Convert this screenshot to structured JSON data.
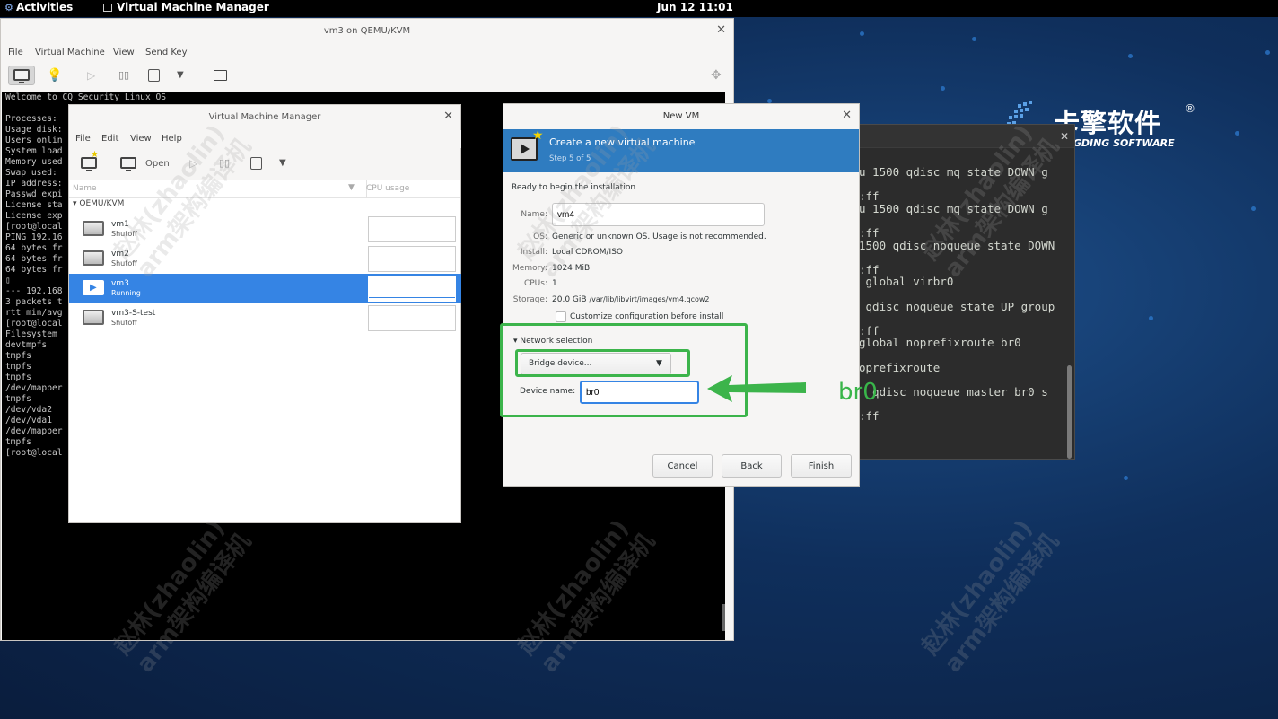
{
  "topbar": {
    "activities": "Activities",
    "app_name": "Virtual Machine Manager",
    "clock": "Jun 12  11:01"
  },
  "brand": {
    "cn": "卡擎软件",
    "en": "KINGDING SOFTWARE",
    "reg": "®"
  },
  "bg_terminal": {
    "lines": [
      "u 1500 qdisc mq state DOWN g",
      "",
      ":ff",
      "u 1500 qdisc mq state DOWN g",
      "",
      ":ff",
      "1500 qdisc noqueue state DOWN",
      "",
      ":ff",
      " global virbr0",
      "",
      " qdisc noqueue state UP group",
      "",
      ":ff",
      "global noprefixroute br0",
      "",
      "oprefixroute",
      "",
      "  qdisc noqueue master br0 s",
      "",
      ":ff"
    ]
  },
  "viewer": {
    "title": "vm3 on QEMU/KVM",
    "menu": [
      "File",
      "Virtual Machine",
      "View",
      "Send Key"
    ],
    "console_lines": [
      "Welcome to CQ Security Linux OS",
      "",
      "Processes:",
      "Usage disk:",
      "Users onlin",
      "System load",
      "Memory used",
      "Swap used:",
      "IP address:",
      "Passwd expi",
      "License sta",
      "License exp",
      "[root@local",
      "PING 192.16",
      "64 bytes fr",
      "64 bytes fr",
      "64 bytes fr",
      "▯",
      "--- 192.168",
      "3 packets t",
      "rtt min/avg",
      "[root@local",
      "Filesystem",
      "devtmpfs",
      "tmpfs",
      "tmpfs",
      "tmpfs",
      "/dev/mapper",
      "tmpfs",
      "/dev/vda2",
      "/dev/vda1",
      "/dev/mapper",
      "tmpfs",
      "[root@local"
    ]
  },
  "vmm": {
    "title": "Virtual Machine Manager",
    "menu": [
      "File",
      "Edit",
      "View",
      "Help"
    ],
    "toolbar": {
      "open": "Open"
    },
    "columns": {
      "name": "Name",
      "cpu": "CPU usage"
    },
    "group": "QEMU/KVM",
    "vms": [
      {
        "name": "vm1",
        "status": "Shutoff"
      },
      {
        "name": "vm2",
        "status": "Shutoff"
      },
      {
        "name": "vm3",
        "status": "Running"
      },
      {
        "name": "vm3-S-test",
        "status": "Shutoff"
      }
    ]
  },
  "newvm": {
    "title": "New VM",
    "banner_title": "Create a new virtual machine",
    "banner_step": "Step 5 of 5",
    "ready": "Ready to begin the installation",
    "labels": {
      "name": "Name:",
      "os": "OS:",
      "install": "Install:",
      "memory": "Memory:",
      "cpus": "CPUs:",
      "storage": "Storage:"
    },
    "name_value": "vm4",
    "os_value": "Generic or unknown OS. Usage is not recommended.",
    "install_value": "Local CDROM/ISO",
    "memory_value": "1024 MiB",
    "cpus_value": "1",
    "storage_size": "20.0 GiB",
    "storage_path": "/var/lib/libvirt/images/vm4.qcow2",
    "customize_label": "Customize configuration before install",
    "network_section": "Network selection",
    "network_source": "Bridge device...",
    "device_label": "Device name:",
    "device_value": "br0",
    "buttons": {
      "cancel": "Cancel",
      "back": "Back",
      "finish": "Finish"
    }
  },
  "annotation": {
    "label": "br0",
    "color": "#3cb44b"
  },
  "watermark": {
    "line1": "赵林(zhaolin)",
    "line2": "arm架构编译机"
  }
}
